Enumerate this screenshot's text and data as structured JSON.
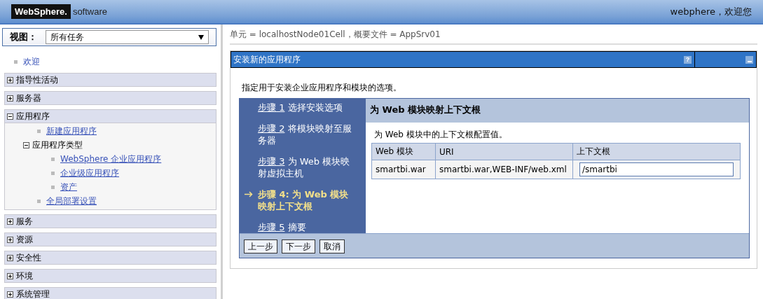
{
  "header": {
    "brand": "WebSphere.",
    "brand_suffix": "software",
    "welcome": "webphere，欢迎您"
  },
  "sidebar": {
    "view_label": "视图：",
    "view_value": "所有任务",
    "items": [
      {
        "kind": "link",
        "label": "欢迎"
      },
      {
        "kind": "section",
        "label": "指导性活动",
        "expanded": false
      },
      {
        "kind": "section",
        "label": "服务器",
        "expanded": false
      },
      {
        "kind": "section",
        "label": "应用程序",
        "expanded": true,
        "children": [
          {
            "kind": "link",
            "label": "新建应用程序"
          },
          {
            "kind": "group",
            "label": "应用程序类型",
            "expanded": true,
            "children": [
              {
                "kind": "link",
                "label": "WebSphere 企业应用程序"
              },
              {
                "kind": "link",
                "label": "企业级应用程序"
              },
              {
                "kind": "link",
                "label": "资产"
              }
            ]
          },
          {
            "kind": "link",
            "label": "全局部署设置"
          }
        ]
      },
      {
        "kind": "section",
        "label": "服务",
        "expanded": false
      },
      {
        "kind": "section",
        "label": "资源",
        "expanded": false
      },
      {
        "kind": "section",
        "label": "安全性",
        "expanded": false
      },
      {
        "kind": "section",
        "label": "环境",
        "expanded": false
      },
      {
        "kind": "section",
        "label": "系统管理",
        "expanded": false
      }
    ]
  },
  "breadcrumb": "单元 = localhostNode01Cell，概要文件 = AppSrv01",
  "panel": {
    "title": "安装新的应用程序",
    "help": "?",
    "intro": "指定用于安装企业应用程序和模块的选项。",
    "steps": [
      {
        "link": "步骤 1",
        "text": "选择安装选项",
        "selected": false
      },
      {
        "link": "步骤 2",
        "text": "将模块映射至服务器",
        "selected": false
      },
      {
        "link": "步骤 3",
        "text": "为 Web 模块映射虚拟主机",
        "selected": false
      },
      {
        "link": "步骤 4:",
        "text": "为 Web 模块映射上下文根",
        "selected": true
      },
      {
        "link": "步骤 5",
        "text": "摘要",
        "selected": false
      }
    ],
    "step_title": "为 Web 模块映射上下文根",
    "step_description": "为 Web 模块中的上下文根配置值。",
    "table": {
      "columns": [
        "Web 模块",
        "URI",
        "上下文根"
      ],
      "rows": [
        {
          "module": "smartbi.war",
          "uri": "smartbi.war,WEB-INF/web.xml",
          "context_root": "/smartbi"
        }
      ]
    },
    "buttons": [
      "上一步",
      "下一步",
      "取消"
    ]
  }
}
